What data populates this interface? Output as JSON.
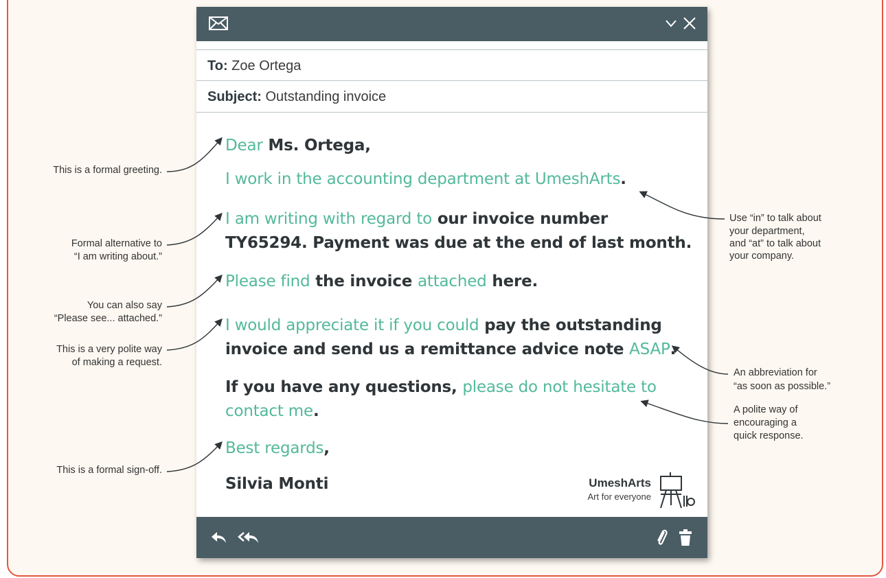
{
  "email": {
    "to_label": "To:",
    "to_value": "Zoe Ortega",
    "subject_label": "Subject:",
    "subject_value": "Outstanding invoice",
    "greeting": {
      "g1": "Dear",
      "b1": " Ms. Ortega,"
    },
    "line1": {
      "g1": "I work in the accounting department at UmeshArts",
      "b1": "."
    },
    "line2": {
      "g1": "I am writing with regard to",
      "b1": " our invoice number TY65294. Payment was due at the end of last month."
    },
    "line3": {
      "g1": "Please find",
      "b1": " the invoice ",
      "g2": "attached",
      "b2": " here."
    },
    "line4": {
      "g1": "I would appreciate it if you could",
      "b1": " pay the outstanding invoice and send us a remittance advice note ",
      "g2": "ASAP",
      "b2": "."
    },
    "line5": {
      "b1": "If you have any questions, ",
      "g1": "please do not hesitate to contact me",
      "b2": "."
    },
    "signoff": {
      "g1": "Best regards",
      "b1": ","
    },
    "signature": "Silvia Monti",
    "logo_name": "UmeshArts",
    "logo_tagline": "Art for everyone"
  },
  "notes": {
    "left": [
      "This is a formal greeting.",
      "Formal alternative to",
      "“I am writing about.”",
      "You can also say",
      "“Please see... attached.”",
      "This is a very polite way",
      "of making a request.",
      "This is a formal sign-off."
    ],
    "right": [
      "Use “in” to talk about",
      "your department,",
      "and “at” to talk about",
      "your company.",
      "An abbreviation for",
      "“as soon as possible.”",
      "A polite way of",
      "encouraging a",
      "quick response."
    ]
  },
  "colors": {
    "accent_green": "#53b99a",
    "toolbar": "#4a5d64",
    "frame_border": "#e5553e"
  },
  "icons": [
    "envelope-icon",
    "chevron-down-icon",
    "close-icon",
    "reply-icon",
    "reply-all-icon",
    "paperclip-icon",
    "trash-icon",
    "easel-icon"
  ]
}
